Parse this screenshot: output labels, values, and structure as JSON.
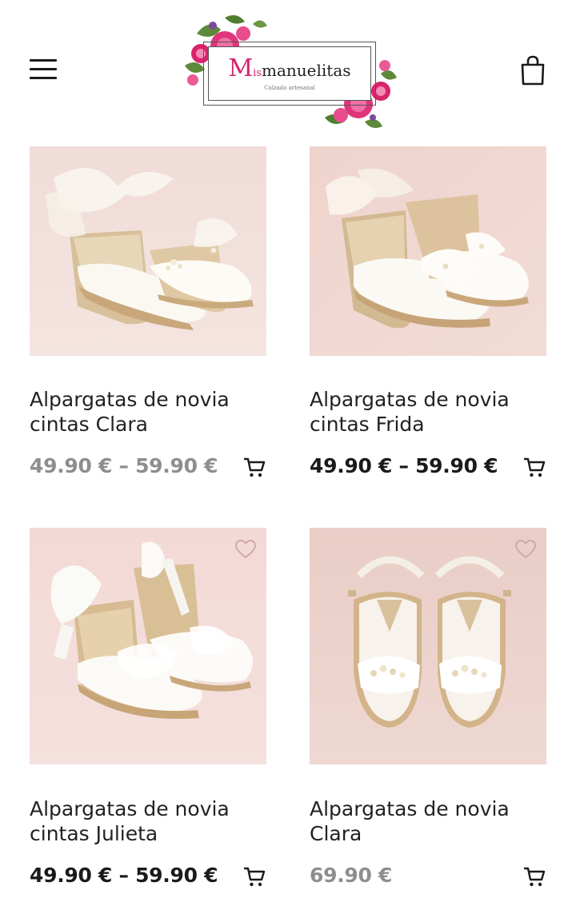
{
  "header": {
    "logo_mark": "M",
    "logo_small": "is",
    "logo_name": "manuelitas",
    "logo_tagline": "Calzado artesanal",
    "menu_icon": "hamburger-menu-icon",
    "cart_icon": "shopping-bag-icon"
  },
  "colors": {
    "accent_pink": "#d6236d",
    "text_dark": "#1a1a1a",
    "price_muted": "#8e8e8e",
    "photo_background": "#f2d8d6"
  },
  "products": [
    {
      "title_line1": "Alpargatas de novia",
      "title_line2": "cintas Clara",
      "price": "49.90 € – 59.90 €",
      "price_muted": true,
      "wishlist_icon": "heart-outline-icon",
      "cart_icon": "add-to-cart-icon"
    },
    {
      "title_line1": "Alpargatas de novia",
      "title_line2": "cintas Frida",
      "price": "49.90 € – 59.90 €",
      "price_muted": false,
      "wishlist_icon": "heart-outline-icon",
      "cart_icon": "add-to-cart-icon"
    },
    {
      "title_line1": "Alpargatas de novia",
      "title_line2": "cintas Julieta",
      "price": "49.90 € – 59.90 €",
      "price_muted": false,
      "wishlist_icon": "heart-outline-icon",
      "cart_icon": "add-to-cart-icon"
    },
    {
      "title_line1": "Alpargatas de novia",
      "title_line2": "Clara",
      "price": "69.90 €",
      "price_muted": true,
      "wishlist_icon": "heart-outline-icon",
      "cart_icon": "add-to-cart-icon"
    }
  ]
}
